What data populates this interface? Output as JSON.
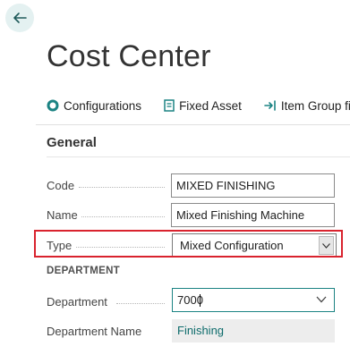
{
  "page": {
    "title": "Cost Center"
  },
  "actions": [
    {
      "label": "Configurations",
      "icon": "configurations-icon"
    },
    {
      "label": "Fixed Asset",
      "icon": "document-icon"
    },
    {
      "label": "Item Group filt",
      "icon": "enter-arrow-icon"
    }
  ],
  "general": {
    "title": "General",
    "code": {
      "label": "Code",
      "value": "MIXED FINISHING"
    },
    "name": {
      "label": "Name",
      "value": "Mixed Finishing Machine"
    },
    "type": {
      "label": "Type",
      "value": "Mixed Configuration"
    }
  },
  "department": {
    "title": "DEPARTMENT",
    "department": {
      "label": "Department",
      "value": "7000"
    },
    "department_name": {
      "label": "Department Name",
      "value": "Finishing"
    }
  },
  "colors": {
    "accent": "#1b8383",
    "highlight": "#d9232e",
    "back_bg": "#e4f1f1"
  }
}
